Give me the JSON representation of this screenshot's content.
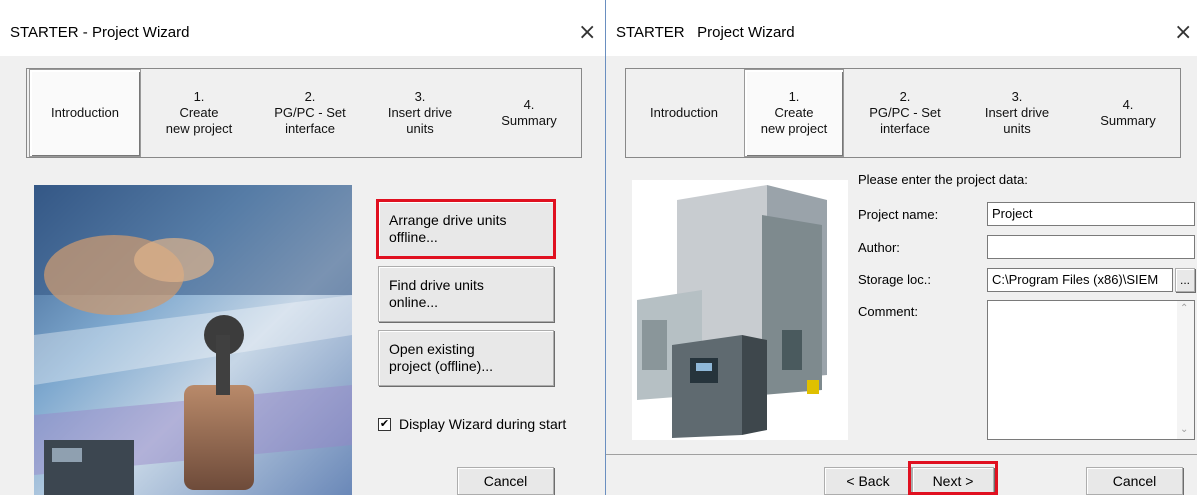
{
  "left": {
    "title": "STARTER - Project Wizard",
    "close": "×",
    "tabs": [
      {
        "label": "Introduction"
      },
      {
        "label": "1.\nCreate\nnew project"
      },
      {
        "label": "2.\nPG/PC - Set\ninterface"
      },
      {
        "label": "3.\nInsert drive\nunits"
      },
      {
        "label": "4.\nSummary"
      }
    ],
    "active_tab": "Introduction",
    "buttons": {
      "arrange": "Arrange drive units\noffline...",
      "find": "Find drive units\nonline...",
      "open": "Open existing\nproject (offline)..."
    },
    "checkbox": {
      "label": "Display Wizard during start",
      "checked": true,
      "mark": "✔"
    },
    "cancel": "Cancel"
  },
  "right": {
    "title": "STARTER   Project Wizard",
    "close": "×",
    "tabs": [
      {
        "label": "Introduction"
      },
      {
        "label": "1.\nCreate\nnew project"
      },
      {
        "label": "2.\nPG/PC - Set\ninterface"
      },
      {
        "label": "3.\nInsert drive\nunits"
      },
      {
        "label": "4.\nSummary"
      }
    ],
    "active_tab": "1. Create new project",
    "form": {
      "heading": "Please enter the project data:",
      "project_name_label": "Project name:",
      "project_name_value": "Project",
      "author_label": "Author:",
      "author_value": "",
      "storage_label": "Storage loc.:",
      "storage_value": "C:\\Program Files (x86)\\SIEM",
      "browse": "...",
      "comment_label": "Comment:",
      "comment_value": ""
    },
    "back": "< Back",
    "next": "Next >",
    "cancel": "Cancel"
  },
  "colors": {
    "highlight": "#e01020",
    "dialog_bg": "#f0f0f0"
  }
}
